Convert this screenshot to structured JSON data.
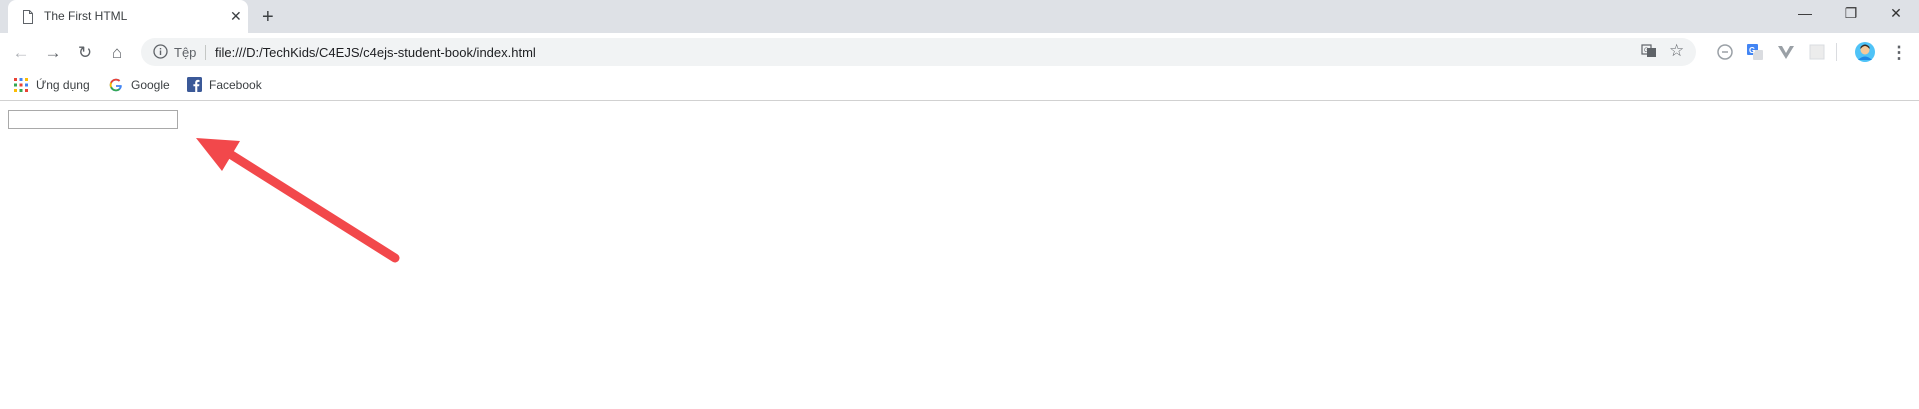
{
  "tab": {
    "title": "The First HTML",
    "close_glyph": "✕",
    "newtab_glyph": "+"
  },
  "window": {
    "minimize_glyph": "—",
    "restore_glyph": "❐",
    "close_glyph": "✕"
  },
  "toolbar": {
    "back_glyph": "←",
    "forward_glyph": "→",
    "reload_glyph": "↻",
    "home_glyph": "⌂",
    "menu_glyph": "⋮"
  },
  "omnibox": {
    "scheme_label": "Tệp",
    "url": "file:///D:/TechKids/C4EJS/c4ejs-student-book/index.html"
  },
  "bookmarks": [
    {
      "label": "Ứng dụng",
      "icon": "apps-grid-icon"
    },
    {
      "label": "Google",
      "icon": "google-g-icon"
    },
    {
      "label": "Facebook",
      "icon": "facebook-icon"
    }
  ],
  "page": {
    "text_input_value": "",
    "annotation": "red-arrow-pointing-to-input"
  },
  "colors": {
    "tabstrip": "#dee1e6",
    "omnibox": "#f1f3f4",
    "arrow": "#f2484b"
  }
}
